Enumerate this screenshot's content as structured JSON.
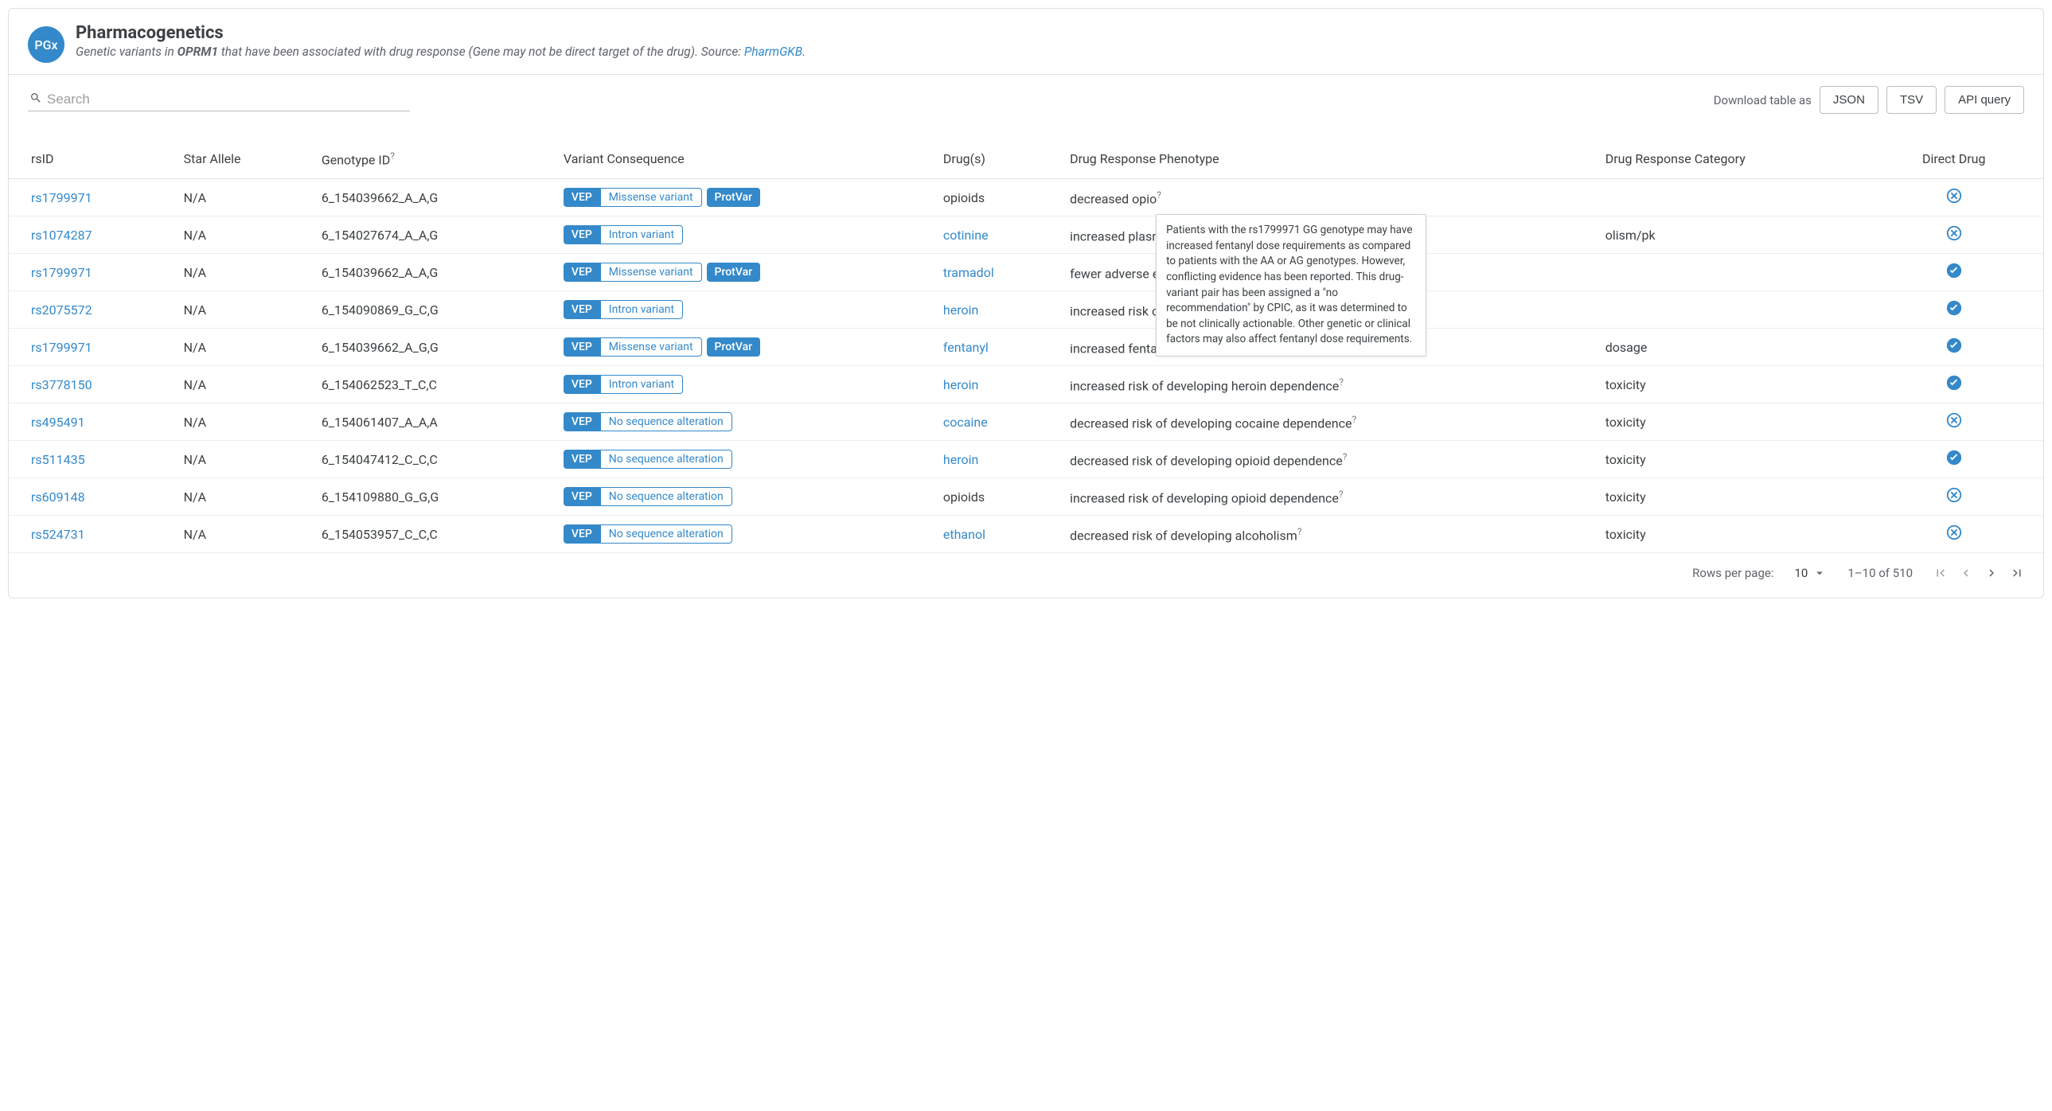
{
  "header": {
    "badge": "PGx",
    "title": "Pharmacogenetics",
    "subtitle_pre": "Genetic variants in ",
    "gene": "OPRM1",
    "subtitle_mid": " that have been associated with drug response (Gene may not be direct target of the drug). Source: ",
    "source_link": "PharmGKB",
    "subtitle_post": "."
  },
  "toolbar": {
    "search_placeholder": "Search",
    "download_label": "Download table as",
    "buttons": [
      "JSON",
      "TSV",
      "API query"
    ]
  },
  "columns": {
    "c0": "rsID",
    "c1": "Star Allele",
    "c2": "Genotype ID",
    "c2_sup": "?",
    "c3": "Variant Consequence",
    "c4": "Drug(s)",
    "c5": "Drug Response Phenotype",
    "c6": "Drug Response Category",
    "c7": "Direct Drug"
  },
  "chips": {
    "vep": "VEP",
    "protvar": "ProtVar"
  },
  "rows": [
    {
      "rs": "rs1799971",
      "star": "N/A",
      "geno": "6_154039662_A_A,G",
      "conseq": "Missense variant",
      "protvar": true,
      "drug": "opioids",
      "drug_link": false,
      "pheno": "decreased opio",
      "cat": "",
      "direct": false
    },
    {
      "rs": "rs1074287",
      "star": "N/A",
      "geno": "6_154027674_A_A,G",
      "conseq": "Intron variant",
      "protvar": false,
      "drug": "cotinine",
      "drug_link": true,
      "pheno": "increased plasm",
      "cat": "olism/pk",
      "direct": false
    },
    {
      "rs": "rs1799971",
      "star": "N/A",
      "geno": "6_154039662_A_A,G",
      "conseq": "Missense variant",
      "protvar": true,
      "drug": "tramadol",
      "drug_link": true,
      "pheno": "fewer adverse e",
      "cat": "",
      "direct": true
    },
    {
      "rs": "rs2075572",
      "star": "N/A",
      "geno": "6_154090869_G_C,G",
      "conseq": "Intron variant",
      "protvar": false,
      "drug": "heroin",
      "drug_link": true,
      "pheno": "increased risk o",
      "cat": "",
      "direct": true
    },
    {
      "rs": "rs1799971",
      "star": "N/A",
      "geno": "6_154039662_A_G,G",
      "conseq": "Missense variant",
      "protvar": true,
      "drug": "fentanyl",
      "drug_link": true,
      "pheno": "increased fentanyl dose requirements",
      "cat": "dosage",
      "direct": true,
      "tooltip": true
    },
    {
      "rs": "rs3778150",
      "star": "N/A",
      "geno": "6_154062523_T_C,C",
      "conseq": "Intron variant",
      "protvar": false,
      "drug": "heroin",
      "drug_link": true,
      "pheno": "increased risk of developing heroin dependence",
      "cat": "toxicity",
      "direct": true
    },
    {
      "rs": "rs495491",
      "star": "N/A",
      "geno": "6_154061407_A_A,A",
      "conseq": "No sequence alteration",
      "protvar": false,
      "drug": "cocaine",
      "drug_link": true,
      "pheno": "decreased risk of developing cocaine dependence",
      "cat": "toxicity",
      "direct": false
    },
    {
      "rs": "rs511435",
      "star": "N/A",
      "geno": "6_154047412_C_C,C",
      "conseq": "No sequence alteration",
      "protvar": false,
      "drug": "heroin",
      "drug_link": true,
      "pheno": "decreased risk of developing opioid dependence",
      "cat": "toxicity",
      "direct": true
    },
    {
      "rs": "rs609148",
      "star": "N/A",
      "geno": "6_154109880_G_G,G",
      "conseq": "No sequence alteration",
      "protvar": false,
      "drug": "opioids",
      "drug_link": false,
      "pheno": "increased risk of developing opioid dependence",
      "cat": "toxicity",
      "direct": false
    },
    {
      "rs": "rs524731",
      "star": "N/A",
      "geno": "6_154053957_C_C,C",
      "conseq": "No sequence alteration",
      "protvar": false,
      "drug": "ethanol",
      "drug_link": true,
      "pheno": "decreased risk of developing alcoholism",
      "cat": "toxicity",
      "direct": false
    }
  ],
  "tooltip_text": "Patients with the rs1799971 GG genotype may have increased fentanyl dose requirements as compared to patients with the AA or AG genotypes. However, conflicting evidence has been reported. This drug-variant pair has been assigned a \"no recommendation\" by CPIC, as it was determined to be not clinically actionable. Other genetic or clinical factors may also affect fentanyl dose requirements.",
  "sup_q": "?",
  "pager": {
    "rows_label": "Rows per page:",
    "rows_value": "10",
    "range": "1–10 of 510"
  }
}
